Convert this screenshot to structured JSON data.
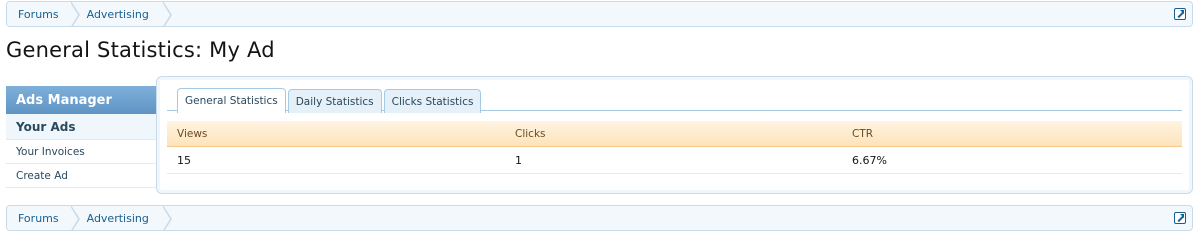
{
  "breadcrumb": {
    "items": [
      {
        "label": "Forums"
      },
      {
        "label": "Advertising"
      }
    ]
  },
  "page": {
    "title": "General Statistics: My Ad"
  },
  "sidebar": {
    "heading": "Ads Manager",
    "section": "Your Ads",
    "links": [
      {
        "label": "Your Invoices"
      },
      {
        "label": "Create Ad"
      }
    ]
  },
  "tabs": [
    {
      "label": "General Statistics",
      "active": true
    },
    {
      "label": "Daily Statistics",
      "active": false
    },
    {
      "label": "Clicks Statistics",
      "active": false
    }
  ],
  "stats": {
    "headers": [
      "Views",
      "Clicks",
      "CTR"
    ],
    "rows": [
      [
        "15",
        "1",
        "6.67%"
      ]
    ]
  },
  "colors": {
    "accent": "#176093",
    "sidebar_heading": "#6ea0cd",
    "table_header": "#fde3b9"
  },
  "icons": {
    "jump_to": "external-link-icon"
  }
}
